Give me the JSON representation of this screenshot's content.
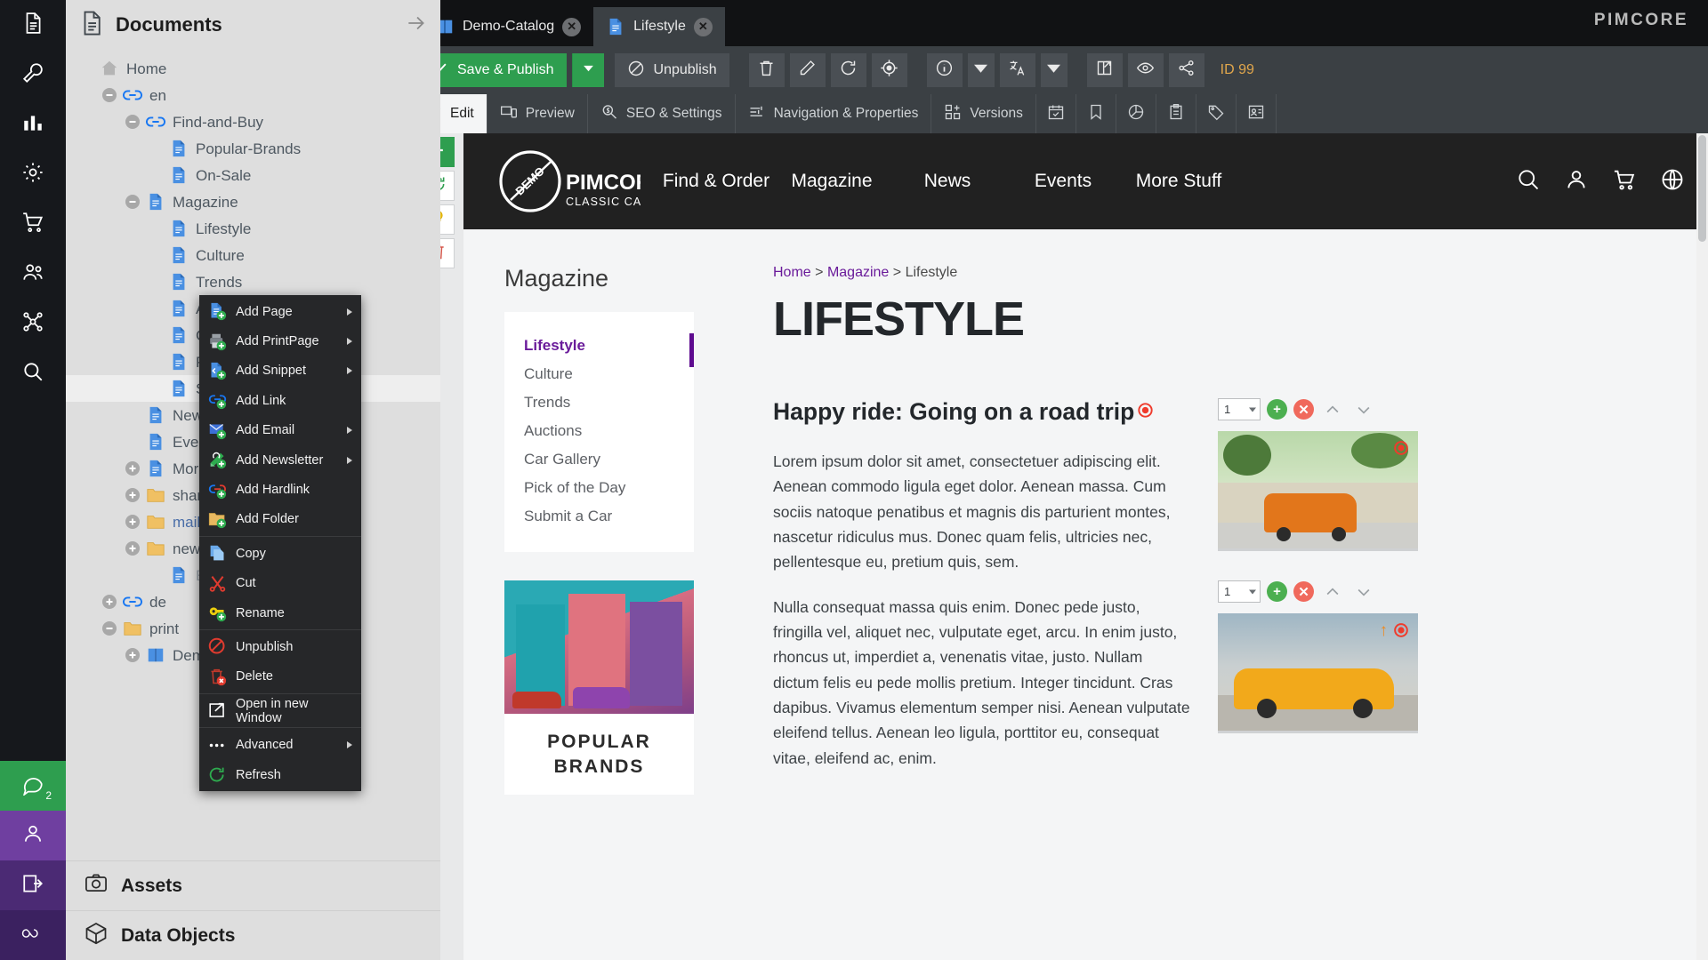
{
  "rail": {
    "items": [
      {
        "name": "documents",
        "icon": "document-icon"
      },
      {
        "name": "tools",
        "icon": "wrench-icon"
      },
      {
        "name": "reports",
        "icon": "bar-chart-icon"
      },
      {
        "name": "settings",
        "icon": "gear-icon"
      },
      {
        "name": "ecommerce",
        "icon": "cart-icon"
      },
      {
        "name": "customers",
        "icon": "users-icon"
      },
      {
        "name": "marketing",
        "icon": "share-nodes-icon"
      },
      {
        "name": "search",
        "icon": "search-icon"
      }
    ],
    "bottom": [
      {
        "name": "notifications",
        "icon": "chat-icon",
        "badge": "2"
      },
      {
        "name": "profile",
        "icon": "user-icon"
      },
      {
        "name": "logout",
        "icon": "logout-icon"
      },
      {
        "name": "pimcore-mark",
        "icon": "infinity-icon"
      }
    ]
  },
  "tree_panel": {
    "title": "Documents",
    "title_icon": "document-icon",
    "collapse_icon": "arrow-right-icon",
    "nodes": [
      {
        "label": "Home",
        "depth": 0,
        "icon": "home-icon",
        "expander": "none",
        "style": "plain"
      },
      {
        "label": "en",
        "depth": 1,
        "icon": "link-icon",
        "expander": "minus",
        "style": "plain"
      },
      {
        "label": "Find-and-Buy",
        "depth": 2,
        "icon": "link-icon",
        "expander": "minus",
        "style": "plain"
      },
      {
        "label": "Popular-Brands",
        "depth": 3,
        "icon": "page-icon",
        "expander": "none",
        "style": "plain"
      },
      {
        "label": "On-Sale",
        "depth": 3,
        "icon": "page-icon",
        "expander": "none",
        "style": "plain"
      },
      {
        "label": "Magazine",
        "depth": 2,
        "icon": "page-icon",
        "expander": "minus",
        "style": "plain"
      },
      {
        "label": "Lifestyle",
        "depth": 3,
        "icon": "page-icon",
        "expander": "none",
        "style": "plain"
      },
      {
        "label": "Culture",
        "depth": 3,
        "icon": "page-icon",
        "expander": "none",
        "style": "plain"
      },
      {
        "label": "Trends",
        "depth": 3,
        "icon": "page-icon",
        "expander": "none",
        "style": "plain"
      },
      {
        "label": "Auctions",
        "depth": 3,
        "icon": "page-icon",
        "expander": "none",
        "style": "plain"
      },
      {
        "label": "Car-Gallery",
        "depth": 3,
        "icon": "page-icon",
        "expander": "none",
        "style": "plain"
      },
      {
        "label": "Pick of the Day",
        "depth": 3,
        "icon": "page-icon",
        "expander": "none",
        "style": "plain"
      },
      {
        "label": "Submit a Car",
        "depth": 3,
        "icon": "page-icon",
        "expander": "none",
        "style": "selected"
      },
      {
        "label": "News",
        "depth": 2,
        "icon": "page-icon",
        "expander": "none",
        "style": "plain"
      },
      {
        "label": "Events",
        "depth": 2,
        "icon": "page-icon",
        "expander": "none",
        "style": "plain"
      },
      {
        "label": "More-Stuff",
        "depth": 2,
        "icon": "page-icon",
        "expander": "plus",
        "style": "plain"
      },
      {
        "label": "shared",
        "depth": 2,
        "icon": "folder-icon",
        "expander": "plus",
        "style": "plain"
      },
      {
        "label": "mails",
        "depth": 2,
        "icon": "folder-icon",
        "expander": "plus",
        "style": "blue"
      },
      {
        "label": "newsletter",
        "depth": 2,
        "icon": "folder-icon",
        "expander": "plus",
        "style": "plain"
      },
      {
        "label": "Error-Page",
        "depth": 3,
        "icon": "page-icon",
        "expander": "none",
        "style": "dim"
      },
      {
        "label": "de",
        "depth": 1,
        "icon": "link-icon",
        "expander": "plus",
        "style": "plain"
      },
      {
        "label": "print",
        "depth": 1,
        "icon": "folder-icon",
        "expander": "minus",
        "style": "plain"
      },
      {
        "label": "Demo-Catalog",
        "depth": 2,
        "icon": "book-icon",
        "expander": "plus",
        "style": "plain"
      }
    ],
    "accordions": [
      {
        "label": "Assets",
        "icon": "camera-icon"
      },
      {
        "label": "Data Objects",
        "icon": "cube-icon"
      }
    ]
  },
  "context_menu": {
    "items": [
      {
        "label": "Add Page",
        "icon": "add-page-icon",
        "submenu": true,
        "sep_after": false
      },
      {
        "label": "Add PrintPage",
        "icon": "add-printpage-icon",
        "submenu": true,
        "sep_after": false
      },
      {
        "label": "Add Snippet",
        "icon": "add-snippet-icon",
        "submenu": true,
        "sep_after": false
      },
      {
        "label": "Add Link",
        "icon": "add-link-icon",
        "submenu": false,
        "sep_after": false
      },
      {
        "label": "Add Email",
        "icon": "add-email-icon",
        "submenu": true,
        "sep_after": false
      },
      {
        "label": "Add Newsletter",
        "icon": "add-newsletter-icon",
        "submenu": true,
        "sep_after": false
      },
      {
        "label": "Add Hardlink",
        "icon": "add-hardlink-icon",
        "submenu": false,
        "sep_after": false
      },
      {
        "label": "Add Folder",
        "icon": "add-folder-icon",
        "submenu": false,
        "sep_after": true
      },
      {
        "label": "Copy",
        "icon": "copy-icon",
        "submenu": false,
        "sep_after": false
      },
      {
        "label": "Cut",
        "icon": "cut-icon",
        "submenu": false,
        "sep_after": false
      },
      {
        "label": "Rename",
        "icon": "rename-icon",
        "submenu": false,
        "sep_after": true
      },
      {
        "label": "Unpublish",
        "icon": "unpublish-icon",
        "submenu": false,
        "sep_after": false
      },
      {
        "label": "Delete",
        "icon": "delete-icon",
        "submenu": false,
        "sep_after": true
      },
      {
        "label": "Open in new Window",
        "icon": "open-new-window-icon",
        "submenu": false,
        "sep_after": true
      },
      {
        "label": "Advanced",
        "icon": "advanced-icon",
        "submenu": true,
        "sep_after": false
      },
      {
        "label": "Refresh",
        "icon": "refresh-icon",
        "submenu": false,
        "sep_after": false
      }
    ]
  },
  "document_tabs": {
    "brand": "PIMCORE",
    "tabs": [
      {
        "label": "Demo-Catalog",
        "icon": "book-icon",
        "active": false,
        "close": "✕"
      },
      {
        "label": "Lifestyle",
        "icon": "page-icon",
        "active": true,
        "close": "✕"
      }
    ]
  },
  "toolbar": {
    "save_publish_label": "Save & Publish",
    "save_publish_icon": "check-icon",
    "save_publish_dropdown_icon": "caret-down-icon",
    "unpublish_label": "Unpublish",
    "unpublish_icon": "no-entry-icon",
    "icon_buttons": [
      {
        "name": "delete-button",
        "icon": "trash-icon"
      },
      {
        "name": "rename-button",
        "icon": "pencil-icon"
      },
      {
        "name": "reload-button",
        "icon": "refresh-icon"
      },
      {
        "name": "locate-button",
        "icon": "target-icon"
      },
      {
        "name": "info-button",
        "icon": "info-icon"
      },
      {
        "name": "info-dropdown",
        "icon": "caret-down-icon"
      },
      {
        "name": "translate-button",
        "icon": "translate-icon"
      },
      {
        "name": "translate-dropdown",
        "icon": "caret-down-icon"
      },
      {
        "name": "open-external-button",
        "icon": "external-link-icon"
      },
      {
        "name": "preview-button",
        "icon": "eye-icon"
      },
      {
        "name": "share-button",
        "icon": "share-icon"
      }
    ],
    "id_label": "ID 99",
    "id_color": "#e0a64c"
  },
  "sub_tabs": [
    {
      "label": "Edit",
      "icon": "pencil-icon",
      "active": true
    },
    {
      "label": "Preview",
      "icon": "device-preview-icon",
      "active": false
    },
    {
      "label": "SEO & Settings",
      "icon": "seo-search-icon",
      "active": false
    },
    {
      "label": "Navigation & Properties",
      "icon": "sliders-icon",
      "active": false
    },
    {
      "label": "Versions",
      "icon": "versions-icon",
      "active": false
    },
    {
      "label": "",
      "icon": "schedule-icon",
      "active": false
    },
    {
      "label": "",
      "icon": "bookmark-icon",
      "active": false
    },
    {
      "label": "",
      "icon": "pie-chart-icon",
      "active": false
    },
    {
      "label": "",
      "icon": "clipboard-icon",
      "active": false
    },
    {
      "label": "",
      "icon": "tag-icon",
      "active": false
    },
    {
      "label": "",
      "icon": "contact-card-icon",
      "active": false
    }
  ],
  "edit_gutter": [
    {
      "name": "add-block-button",
      "icon": "plus-icon",
      "color": "#2e9e4f"
    },
    {
      "name": "reload-block-button",
      "icon": "refresh-icon",
      "color": "#2e9e4f"
    },
    {
      "name": "hint-button",
      "icon": "lightbulb-icon",
      "color": "#e8b71a"
    },
    {
      "name": "remove-block-button",
      "icon": "trash-icon",
      "color": "#d6564a"
    }
  ],
  "site": {
    "logo": {
      "top": "DEMO",
      "main": "PIMCORE",
      "sub": "CLASSIC CARS"
    },
    "nav": [
      "Find & Order",
      "Magazine",
      "News",
      "Events",
      "More Stuff"
    ],
    "header_icons": [
      "search-icon",
      "user-icon",
      "cart-icon",
      "globe-icon"
    ],
    "sidebar": {
      "title": "Magazine",
      "items": [
        {
          "label": "Lifestyle",
          "active": true
        },
        {
          "label": "Culture",
          "active": false
        },
        {
          "label": "Trends",
          "active": false
        },
        {
          "label": "Auctions",
          "active": false
        },
        {
          "label": "Car Gallery",
          "active": false
        },
        {
          "label": "Pick of the Day",
          "active": false
        },
        {
          "label": "Submit a Car",
          "active": false
        }
      ]
    },
    "promo": {
      "line1": "POPULAR",
      "line2": "BRANDS"
    },
    "breadcrumb": {
      "home": "Home",
      "sep1": ">",
      "magazine": "Magazine",
      "sep2": ">",
      "current": "Lifestyle"
    },
    "page_title": "LIFESTYLE",
    "article": {
      "heading": "Happy ride: Going on a road trip",
      "paragraphs": [
        "Lorem ipsum dolor sit amet, consectetuer adipiscing elit. Aenean commodo ligula eget dolor. Aenean massa. Cum sociis natoque penatibus et magnis dis parturient montes, nascetur ridiculus mus. Donec quam felis, ultricies nec, pellentesque eu, pretium quis, sem.",
        "Nulla consequat massa quis enim. Donec pede justo, fringilla vel, aliquet nec, vulputate eget, arcu. In enim justo, rhoncus ut, imperdiet a, venenatis vitae, justo. Nullam dictum felis eu pede mollis pretium. Integer tincidunt. Cras dapibus. Vivamus elementum semper nisi. Aenean vulputate eleifend tellus. Aenean leo ligula, porttitor eu, consequat vitae, eleifend ac, enim."
      ]
    },
    "image_blocks": [
      {
        "index_value": "1",
        "add": "+",
        "remove": "✕",
        "up": "up-chevron-icon",
        "down": "down-chevron-icon",
        "alt": "orange-fiat-500-by-wall"
      },
      {
        "index_value": "1",
        "add": "+",
        "remove": "✕",
        "up": "up-chevron-icon",
        "down": "down-chevron-icon",
        "alt": "yellow-porsche-targa"
      }
    ]
  },
  "colors": {
    "accent_green": "#2e9e4f",
    "accent_purple": "#6a1b9a",
    "rail_bg": "#16181c",
    "panel_bg": "#dedede",
    "toolbar_bg": "#3b4044",
    "id_orange": "#e0a64c"
  }
}
